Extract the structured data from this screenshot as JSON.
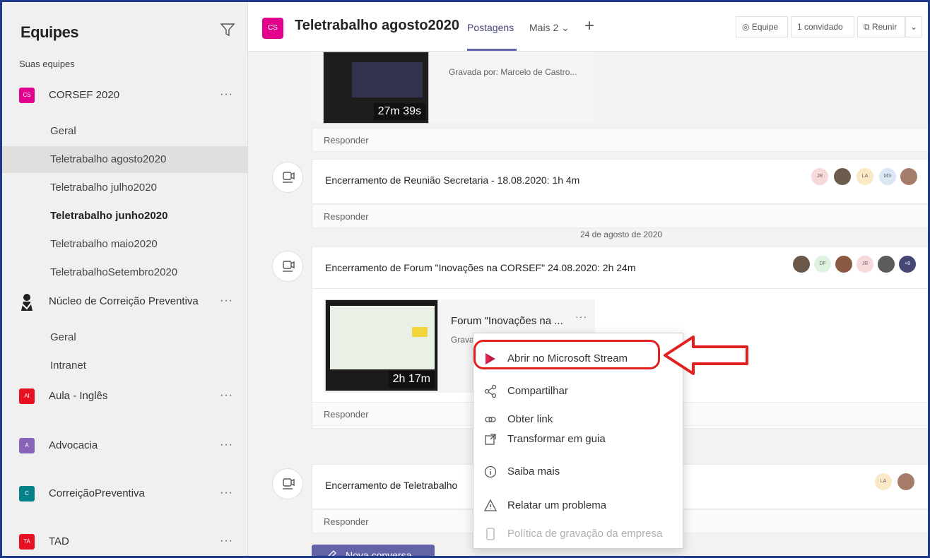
{
  "sidebar": {
    "title": "Equipes",
    "section_label": "Suas equipes",
    "teams": [
      {
        "initials": "CS",
        "name": "CORSEF 2020",
        "color": "#e3008c"
      },
      {
        "initials": "",
        "name": "Núcleo de Correição Preventiva",
        "color": "#ffffff"
      },
      {
        "initials": "AI",
        "name": "Aula - Inglês",
        "color": "#e81123"
      },
      {
        "initials": "A",
        "name": "Advocacia",
        "color": "#8764b8"
      },
      {
        "initials": "C",
        "name": "CorreiçãoPreventiva",
        "color": "#038387"
      },
      {
        "initials": "TA",
        "name": "TAD",
        "color": "#e81123"
      }
    ],
    "channels_corsef": [
      "Geral",
      "Teletrabalho agosto2020",
      "Teletrabalho julho2020",
      "Teletrabalho junho2020",
      "Teletrabalho maio2020",
      "TeletrabalhoSetembro2020"
    ],
    "channels_nucleo": [
      "Geral",
      "Intranet"
    ],
    "more": "···"
  },
  "header": {
    "initials": "CS",
    "title": "Teletrabalho agosto2020",
    "tab_active": "Postagens",
    "tab_more": "Mais 2",
    "team_btn": "Equipe",
    "guest_btn": "1 convidado",
    "meet_btn": "Reunir"
  },
  "feed": {
    "post1": {
      "recorded_by": "Gravada por: Marcelo de Castro...",
      "duration": "27m 39s",
      "reply": "Responder"
    },
    "post2": {
      "title": "Encerramento de Reunião Secretaria - 18.08.2020: 1h 4m",
      "reply": "Responder",
      "avatars": [
        "JR",
        "",
        "LA",
        "MS",
        ""
      ]
    },
    "date_separator": "24 de agosto de 2020",
    "post3": {
      "title": "Encerramento de Forum \"Inovações na CORSEF\" 24.08.2020: 2h 24m",
      "video_title": "Forum \"Inovações na ...",
      "recorded_by": "Grava",
      "duration": "2h 17m",
      "reply": "Responder",
      "avatars": [
        "",
        "DF",
        "",
        "JR",
        "",
        "+8"
      ]
    },
    "post4": {
      "title": "Encerramento de Teletrabalho",
      "reply": "Responder",
      "avatars": [
        "LA",
        ""
      ]
    },
    "new_conversation": "Nova conversa"
  },
  "context_menu": {
    "items": [
      {
        "label": "Abrir no Microsoft Stream",
        "icon": "stream-icon"
      },
      {
        "label": "Compartilhar",
        "icon": "share-icon"
      },
      {
        "label": "Obter link",
        "icon": "link-icon"
      },
      {
        "label": "Transformar em guia",
        "icon": "tab-icon"
      },
      {
        "label": "Saiba mais",
        "icon": "info-icon"
      },
      {
        "label": "Relatar um problema",
        "icon": "warning-icon"
      },
      {
        "label": "Política de gravação da empresa",
        "icon": "policy-icon"
      }
    ]
  },
  "colors": {
    "accent": "#6264a7",
    "highlight": "#e32020"
  }
}
